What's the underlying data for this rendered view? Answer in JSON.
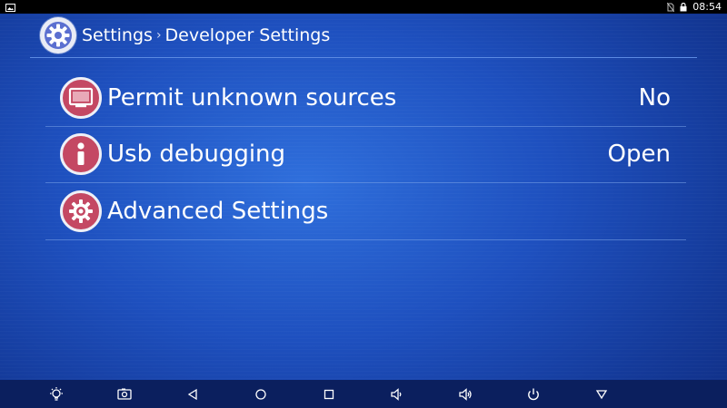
{
  "status_bar": {
    "time": "08:54",
    "left_icon": "image-icon",
    "right_icons": [
      "no-sim-icon",
      "lock-icon"
    ]
  },
  "header": {
    "icon": "gear-icon",
    "root": "Settings",
    "separator": "›",
    "current": "Developer Settings"
  },
  "settings_items": [
    {
      "label": "Permit unknown sources",
      "value": "No",
      "icon": "monitor-icon"
    },
    {
      "label": "Usb debugging",
      "value": "Open",
      "icon": "info-icon"
    },
    {
      "label": "Advanced Settings",
      "value": "",
      "icon": "gear-icon"
    }
  ],
  "nav_bar": {
    "buttons": [
      "brightness-icon",
      "screenshot-icon",
      "back-icon",
      "home-icon",
      "recents-icon",
      "volume-down-icon",
      "volume-up-icon",
      "power-icon",
      "menu-down-icon"
    ]
  },
  "colors": {
    "background": "#1e50bf",
    "icon_fill": "#c44863",
    "icon_ring": "#eef0f7",
    "nav_bar": "#0b1f5e",
    "status_bar": "#000000"
  }
}
